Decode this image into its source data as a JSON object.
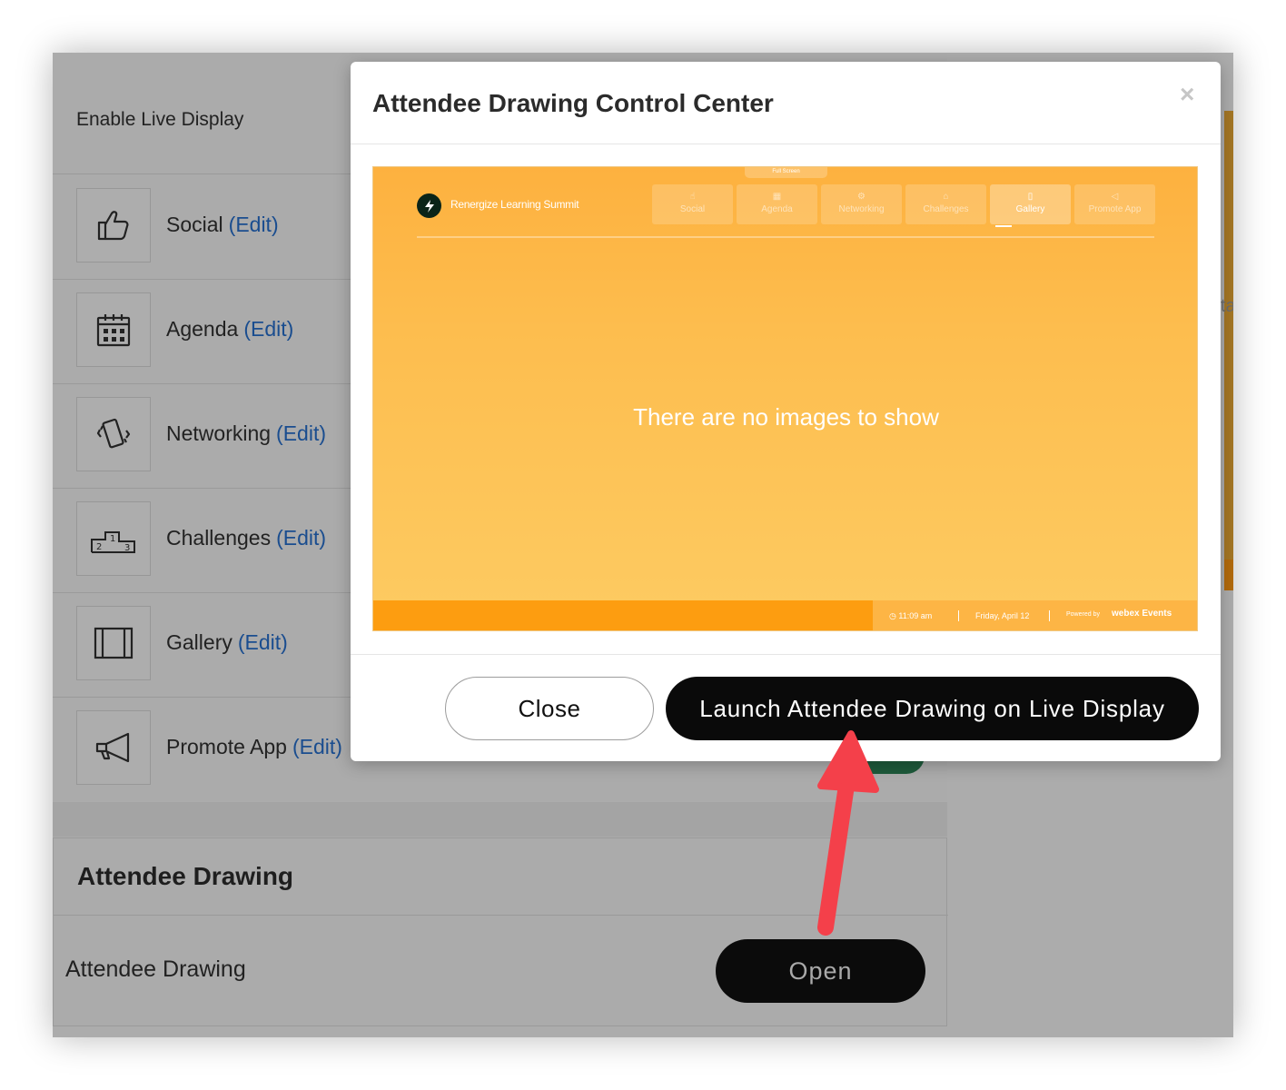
{
  "background": {
    "enable_label": "Enable Live Display",
    "tabs": [
      {
        "label": "Social",
        "edit": "(Edit)",
        "icon": "thumbs-up-icon"
      },
      {
        "label": "Agenda",
        "edit": "(Edit)",
        "icon": "calendar-icon"
      },
      {
        "label": "Networking",
        "edit": "(Edit)",
        "icon": "vibrating-phone-icon"
      },
      {
        "label": "Challenges",
        "edit": "(Edit)",
        "icon": "podium-icon"
      },
      {
        "label": "Gallery",
        "edit": "(Edit)",
        "icon": "gallery-icon"
      },
      {
        "label": "Promote App",
        "edit": "(Edit)",
        "icon": "megaphone-icon"
      }
    ],
    "attendee_section": {
      "title": "Attendee Drawing",
      "row_label": "Attendee Drawing",
      "open_button": "Open"
    },
    "right_peek_text": "ta"
  },
  "modal": {
    "title": "Attendee Drawing Control Center",
    "close_icon": "×",
    "preview": {
      "fullscreen_label": "Full Screen",
      "brand": "Renergize Learning Summit",
      "tabs": [
        {
          "label": "Social",
          "icon": "☝"
        },
        {
          "label": "Agenda",
          "icon": "▦"
        },
        {
          "label": "Networking",
          "icon": "⚙"
        },
        {
          "label": "Challenges",
          "icon": "⌂"
        },
        {
          "label": "Gallery",
          "icon": "▯"
        },
        {
          "label": "Promote App",
          "icon": "◁"
        }
      ],
      "active_tab": "Gallery",
      "empty_message": "There are no images to show",
      "footer": {
        "time": "11:09 am",
        "date": "Friday, April 12",
        "powered_by": "Powered by",
        "brand": "webex Events"
      },
      "colors": {
        "header": "#fdb13f",
        "footer": "#fd9d10"
      }
    },
    "buttons": {
      "close": "Close",
      "launch": "Launch Attendee Drawing on Live Display"
    }
  },
  "annotation": {
    "arrow_color": "#f4404a"
  }
}
